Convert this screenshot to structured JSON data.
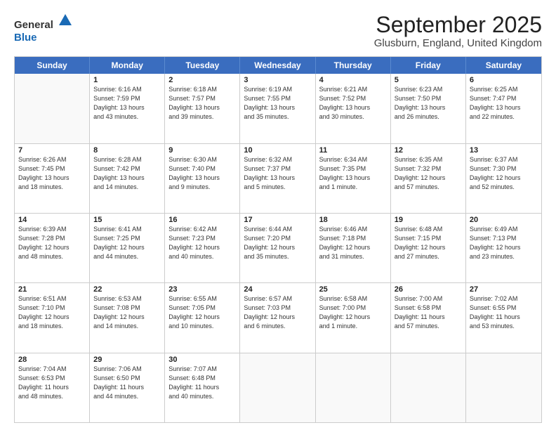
{
  "header": {
    "logo_line1": "General",
    "logo_line2": "Blue",
    "month": "September 2025",
    "location": "Glusburn, England, United Kingdom"
  },
  "weekdays": [
    "Sunday",
    "Monday",
    "Tuesday",
    "Wednesday",
    "Thursday",
    "Friday",
    "Saturday"
  ],
  "rows": [
    [
      {
        "day": "",
        "lines": []
      },
      {
        "day": "1",
        "lines": [
          "Sunrise: 6:16 AM",
          "Sunset: 7:59 PM",
          "Daylight: 13 hours",
          "and 43 minutes."
        ]
      },
      {
        "day": "2",
        "lines": [
          "Sunrise: 6:18 AM",
          "Sunset: 7:57 PM",
          "Daylight: 13 hours",
          "and 39 minutes."
        ]
      },
      {
        "day": "3",
        "lines": [
          "Sunrise: 6:19 AM",
          "Sunset: 7:55 PM",
          "Daylight: 13 hours",
          "and 35 minutes."
        ]
      },
      {
        "day": "4",
        "lines": [
          "Sunrise: 6:21 AM",
          "Sunset: 7:52 PM",
          "Daylight: 13 hours",
          "and 30 minutes."
        ]
      },
      {
        "day": "5",
        "lines": [
          "Sunrise: 6:23 AM",
          "Sunset: 7:50 PM",
          "Daylight: 13 hours",
          "and 26 minutes."
        ]
      },
      {
        "day": "6",
        "lines": [
          "Sunrise: 6:25 AM",
          "Sunset: 7:47 PM",
          "Daylight: 13 hours",
          "and 22 minutes."
        ]
      }
    ],
    [
      {
        "day": "7",
        "lines": [
          "Sunrise: 6:26 AM",
          "Sunset: 7:45 PM",
          "Daylight: 13 hours",
          "and 18 minutes."
        ]
      },
      {
        "day": "8",
        "lines": [
          "Sunrise: 6:28 AM",
          "Sunset: 7:42 PM",
          "Daylight: 13 hours",
          "and 14 minutes."
        ]
      },
      {
        "day": "9",
        "lines": [
          "Sunrise: 6:30 AM",
          "Sunset: 7:40 PM",
          "Daylight: 13 hours",
          "and 9 minutes."
        ]
      },
      {
        "day": "10",
        "lines": [
          "Sunrise: 6:32 AM",
          "Sunset: 7:37 PM",
          "Daylight: 13 hours",
          "and 5 minutes."
        ]
      },
      {
        "day": "11",
        "lines": [
          "Sunrise: 6:34 AM",
          "Sunset: 7:35 PM",
          "Daylight: 13 hours",
          "and 1 minute."
        ]
      },
      {
        "day": "12",
        "lines": [
          "Sunrise: 6:35 AM",
          "Sunset: 7:32 PM",
          "Daylight: 12 hours",
          "and 57 minutes."
        ]
      },
      {
        "day": "13",
        "lines": [
          "Sunrise: 6:37 AM",
          "Sunset: 7:30 PM",
          "Daylight: 12 hours",
          "and 52 minutes."
        ]
      }
    ],
    [
      {
        "day": "14",
        "lines": [
          "Sunrise: 6:39 AM",
          "Sunset: 7:28 PM",
          "Daylight: 12 hours",
          "and 48 minutes."
        ]
      },
      {
        "day": "15",
        "lines": [
          "Sunrise: 6:41 AM",
          "Sunset: 7:25 PM",
          "Daylight: 12 hours",
          "and 44 minutes."
        ]
      },
      {
        "day": "16",
        "lines": [
          "Sunrise: 6:42 AM",
          "Sunset: 7:23 PM",
          "Daylight: 12 hours",
          "and 40 minutes."
        ]
      },
      {
        "day": "17",
        "lines": [
          "Sunrise: 6:44 AM",
          "Sunset: 7:20 PM",
          "Daylight: 12 hours",
          "and 35 minutes."
        ]
      },
      {
        "day": "18",
        "lines": [
          "Sunrise: 6:46 AM",
          "Sunset: 7:18 PM",
          "Daylight: 12 hours",
          "and 31 minutes."
        ]
      },
      {
        "day": "19",
        "lines": [
          "Sunrise: 6:48 AM",
          "Sunset: 7:15 PM",
          "Daylight: 12 hours",
          "and 27 minutes."
        ]
      },
      {
        "day": "20",
        "lines": [
          "Sunrise: 6:49 AM",
          "Sunset: 7:13 PM",
          "Daylight: 12 hours",
          "and 23 minutes."
        ]
      }
    ],
    [
      {
        "day": "21",
        "lines": [
          "Sunrise: 6:51 AM",
          "Sunset: 7:10 PM",
          "Daylight: 12 hours",
          "and 18 minutes."
        ]
      },
      {
        "day": "22",
        "lines": [
          "Sunrise: 6:53 AM",
          "Sunset: 7:08 PM",
          "Daylight: 12 hours",
          "and 14 minutes."
        ]
      },
      {
        "day": "23",
        "lines": [
          "Sunrise: 6:55 AM",
          "Sunset: 7:05 PM",
          "Daylight: 12 hours",
          "and 10 minutes."
        ]
      },
      {
        "day": "24",
        "lines": [
          "Sunrise: 6:57 AM",
          "Sunset: 7:03 PM",
          "Daylight: 12 hours",
          "and 6 minutes."
        ]
      },
      {
        "day": "25",
        "lines": [
          "Sunrise: 6:58 AM",
          "Sunset: 7:00 PM",
          "Daylight: 12 hours",
          "and 1 minute."
        ]
      },
      {
        "day": "26",
        "lines": [
          "Sunrise: 7:00 AM",
          "Sunset: 6:58 PM",
          "Daylight: 11 hours",
          "and 57 minutes."
        ]
      },
      {
        "day": "27",
        "lines": [
          "Sunrise: 7:02 AM",
          "Sunset: 6:55 PM",
          "Daylight: 11 hours",
          "and 53 minutes."
        ]
      }
    ],
    [
      {
        "day": "28",
        "lines": [
          "Sunrise: 7:04 AM",
          "Sunset: 6:53 PM",
          "Daylight: 11 hours",
          "and 48 minutes."
        ]
      },
      {
        "day": "29",
        "lines": [
          "Sunrise: 7:06 AM",
          "Sunset: 6:50 PM",
          "Daylight: 11 hours",
          "and 44 minutes."
        ]
      },
      {
        "day": "30",
        "lines": [
          "Sunrise: 7:07 AM",
          "Sunset: 6:48 PM",
          "Daylight: 11 hours",
          "and 40 minutes."
        ]
      },
      {
        "day": "",
        "lines": []
      },
      {
        "day": "",
        "lines": []
      },
      {
        "day": "",
        "lines": []
      },
      {
        "day": "",
        "lines": []
      }
    ]
  ]
}
